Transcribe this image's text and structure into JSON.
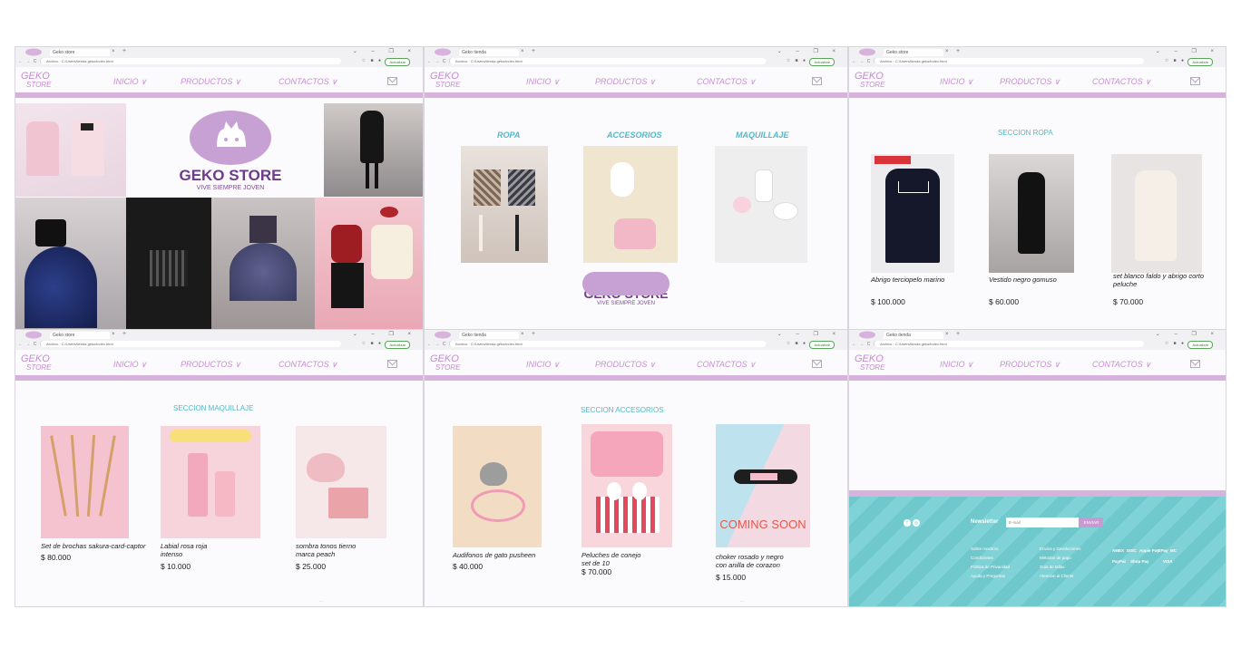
{
  "browser": {
    "tab_titles": [
      "Geko store",
      "Geko tienda",
      "Geko store",
      "Geko store",
      "Geko tienda",
      "Geko tienda"
    ],
    "url_text": "Archivo · C:/Users/tienda geko/index.html",
    "update_label": "Actualizar",
    "reading_list": "Lista de lectura",
    "new_tab": "+",
    "close_tab": "×",
    "window_controls": "⌄ – ❐ ×",
    "nav_icons": "← → C ⓘ"
  },
  "header": {
    "logo_line1": "GEKO",
    "logo_line2": "STORE",
    "nav": [
      "INICIO ∨",
      "PRODUCTOS ∨",
      "CONTACTOS ∨"
    ],
    "mail_icon": "mail-icon"
  },
  "home": {
    "brand_name": "GEKO STORE",
    "slogan": "VIVE SIEMPRE JOVEN"
  },
  "categories": {
    "items": [
      "ROPA",
      "ACCESORIOS",
      "MAQUILLAJE"
    ],
    "brand_name": "GEKO STORE",
    "slogan": "VIVE SIEMPRE JOVEN"
  },
  "ropa": {
    "title": "SECCION ROPA",
    "products": [
      {
        "name": "Abrigo terciopelo marino",
        "price": "$ 100.000"
      },
      {
        "name": "Vestido negro gomuso",
        "price": "$ 60.000"
      },
      {
        "name": "set blanco faldo y abrigo corto peluche",
        "price": "$ 70.000"
      }
    ]
  },
  "maquillaje": {
    "title": "SECCION MAQUILLAJE",
    "products": [
      {
        "name": "Set de brochas sakura-card-captor",
        "price": "$ 80.000"
      },
      {
        "name": "Labial rosa roja intenso",
        "price": "$ 10.000"
      },
      {
        "name": "sombra tonos tierno marca peach",
        "price": "$ 25.000"
      }
    ]
  },
  "accesorios": {
    "title": "SECCION ACCESORIOS",
    "products": [
      {
        "name": "Audifonos de gato pusheen",
        "price": "$ 40.000"
      },
      {
        "name": "Peluches de conejo set de 10",
        "price": "$ 70.000"
      },
      {
        "name": "choker rosado y negro con anilla de corazon",
        "price": "$ 15.000"
      }
    ],
    "coming_soon": "COMING SOON"
  },
  "footer": {
    "newsletter_label": "Newsletter",
    "email_placeholder": "E-mail",
    "send_label": "ENVIAR",
    "links_col1": [
      "Sobre nosotros",
      "Condiciones",
      "Politica de Privacidad",
      "Ayuda y Preguntas"
    ],
    "links_col2": [
      "Envíos y Devoluciones",
      "Metodos de pago",
      "Guia de tallas",
      "Atencion al Cliente"
    ],
    "payments": [
      "AMEX",
      "DISC",
      "Apple Pay",
      "GPay",
      "MC",
      "PayPal",
      "Shop Pay",
      "VISA"
    ],
    "social_icons": [
      "facebook-icon",
      "instagram-icon"
    ]
  },
  "colors": {
    "accent_pink": "#d6b2dd",
    "nav_text": "#c88fd6",
    "section_title": "#52b9c9",
    "footer_teal": "#6fc8cc",
    "brand_purple": "#6e3b8a"
  }
}
